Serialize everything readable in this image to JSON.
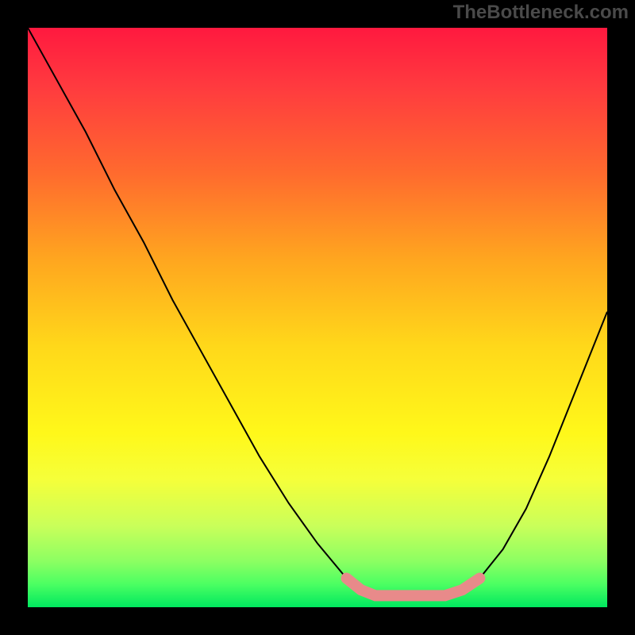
{
  "watermark": "TheBottleneck.com",
  "chart_data": {
    "type": "line",
    "title": "",
    "xlabel": "",
    "ylabel": "",
    "xlim": [
      0,
      1
    ],
    "ylim": [
      0,
      1
    ],
    "series": [
      {
        "name": "black-curve",
        "x": [
          0.0,
          0.05,
          0.1,
          0.15,
          0.2,
          0.25,
          0.3,
          0.35,
          0.4,
          0.45,
          0.5,
          0.55,
          0.575,
          0.6,
          0.63,
          0.66,
          0.69,
          0.72,
          0.75,
          0.78,
          0.82,
          0.86,
          0.9,
          0.94,
          0.98,
          1.0
        ],
        "y": [
          1.0,
          0.91,
          0.82,
          0.72,
          0.63,
          0.53,
          0.44,
          0.35,
          0.26,
          0.18,
          0.11,
          0.05,
          0.03,
          0.02,
          0.02,
          0.02,
          0.02,
          0.02,
          0.03,
          0.05,
          0.1,
          0.17,
          0.26,
          0.36,
          0.46,
          0.51
        ],
        "color": "#000000"
      },
      {
        "name": "pink-overlay",
        "x": [
          0.55,
          0.575,
          0.6,
          0.63,
          0.66,
          0.69,
          0.72,
          0.75,
          0.78
        ],
        "y": [
          0.05,
          0.03,
          0.02,
          0.02,
          0.02,
          0.02,
          0.02,
          0.03,
          0.05
        ],
        "color": "#e88a8a"
      }
    ]
  }
}
